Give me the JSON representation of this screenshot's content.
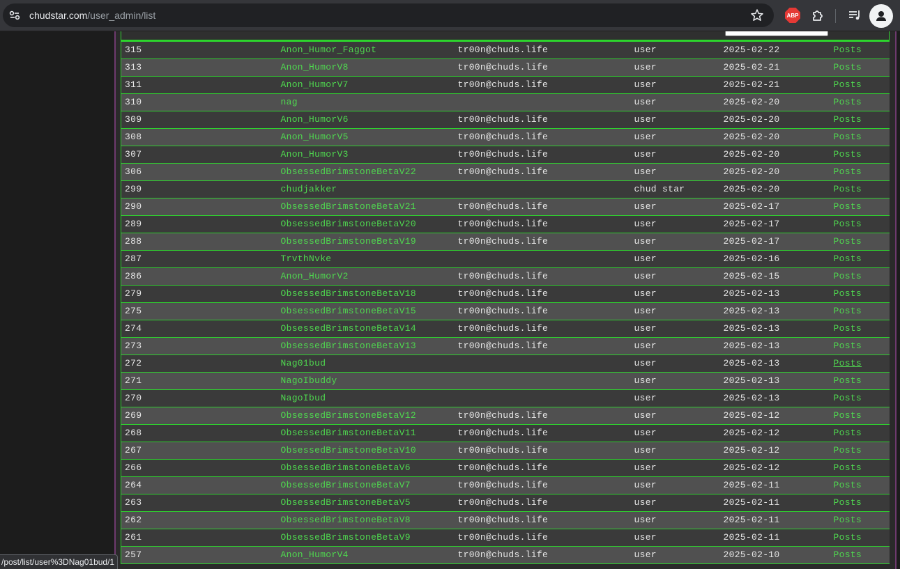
{
  "browser": {
    "url_host": "chudstar.com",
    "url_path": "/user_admin/list",
    "icons": [
      "tune-icon",
      "star-icon",
      "adblock-plus-icon",
      "extensions-icon",
      "media-controls-icon",
      "profile-icon"
    ],
    "abp_text": "ABP"
  },
  "status_bar": "/post/list/user%3DNag01bud/1",
  "colors": {
    "accent": "#2bd62b",
    "link": "#4fd84f",
    "row_dark": "#3a3a3a",
    "row_light": "#505050",
    "rule": "#6e3a6e"
  },
  "users": [
    {
      "id": "315",
      "name": "Anon_Humor_Faggot",
      "email": "tr00n@chuds.life",
      "role": "user",
      "date": "2025-02-22",
      "posts": "Posts"
    },
    {
      "id": "313",
      "name": "Anon_HumorV8",
      "email": "tr00n@chuds.life",
      "role": "user",
      "date": "2025-02-21",
      "posts": "Posts"
    },
    {
      "id": "311",
      "name": "Anon_HumorV7",
      "email": "tr00n@chuds.life",
      "role": "user",
      "date": "2025-02-21",
      "posts": "Posts"
    },
    {
      "id": "310",
      "name": "nag",
      "email": "",
      "role": "user",
      "date": "2025-02-20",
      "posts": "Posts"
    },
    {
      "id": "309",
      "name": "Anon_HumorV6",
      "email": "tr00n@chuds.life",
      "role": "user",
      "date": "2025-02-20",
      "posts": "Posts"
    },
    {
      "id": "308",
      "name": "Anon_HumorV5",
      "email": "tr00n@chuds.life",
      "role": "user",
      "date": "2025-02-20",
      "posts": "Posts"
    },
    {
      "id": "307",
      "name": "Anon_HumorV3",
      "email": "tr00n@chuds.life",
      "role": "user",
      "date": "2025-02-20",
      "posts": "Posts"
    },
    {
      "id": "306",
      "name": "ObsessedBrimstoneBetaV22",
      "email": "tr00n@chuds.life",
      "role": "user",
      "date": "2025-02-20",
      "posts": "Posts"
    },
    {
      "id": "299",
      "name": "chudjakker",
      "email": "",
      "role": "chud star",
      "date": "2025-02-20",
      "posts": "Posts"
    },
    {
      "id": "290",
      "name": "ObsessedBrimstoneBetaV21",
      "email": "tr00n@chuds.life",
      "role": "user",
      "date": "2025-02-17",
      "posts": "Posts"
    },
    {
      "id": "289",
      "name": "ObsessedBrimstoneBetaV20",
      "email": "tr00n@chuds.life",
      "role": "user",
      "date": "2025-02-17",
      "posts": "Posts"
    },
    {
      "id": "288",
      "name": "ObsessedBrimstoneBetaV19",
      "email": "tr00n@chuds.life",
      "role": "user",
      "date": "2025-02-17",
      "posts": "Posts"
    },
    {
      "id": "287",
      "name": "TrvthNvke",
      "email": "",
      "role": "user",
      "date": "2025-02-16",
      "posts": "Posts"
    },
    {
      "id": "286",
      "name": "Anon_HumorV2",
      "email": "tr00n@chuds.life",
      "role": "user",
      "date": "2025-02-15",
      "posts": "Posts"
    },
    {
      "id": "279",
      "name": "ObsessedBrimstoneBetaV18",
      "email": "tr00n@chuds.life",
      "role": "user",
      "date": "2025-02-13",
      "posts": "Posts"
    },
    {
      "id": "275",
      "name": "ObsessedBrimstoneBetaV15",
      "email": "tr00n@chuds.life",
      "role": "user",
      "date": "2025-02-13",
      "posts": "Posts"
    },
    {
      "id": "274",
      "name": "ObsessedBrimstoneBetaV14",
      "email": "tr00n@chuds.life",
      "role": "user",
      "date": "2025-02-13",
      "posts": "Posts"
    },
    {
      "id": "273",
      "name": "ObsessedBrimstoneBetaV13",
      "email": "tr00n@chuds.life",
      "role": "user",
      "date": "2025-02-13",
      "posts": "Posts"
    },
    {
      "id": "272",
      "name": "Nag01bud",
      "email": "",
      "role": "user",
      "date": "2025-02-13",
      "posts": "Posts",
      "hovered": true
    },
    {
      "id": "271",
      "name": "NagoIbuddy",
      "email": "",
      "role": "user",
      "date": "2025-02-13",
      "posts": "Posts"
    },
    {
      "id": "270",
      "name": "NagoIbud",
      "email": "",
      "role": "user",
      "date": "2025-02-13",
      "posts": "Posts"
    },
    {
      "id": "269",
      "name": "ObsessedBrimstoneBetaV12",
      "email": "tr00n@chuds.life",
      "role": "user",
      "date": "2025-02-12",
      "posts": "Posts"
    },
    {
      "id": "268",
      "name": "ObsessedBrimstoneBetaV11",
      "email": "tr00n@chuds.life",
      "role": "user",
      "date": "2025-02-12",
      "posts": "Posts"
    },
    {
      "id": "267",
      "name": "ObsessedBrimstoneBetaV10",
      "email": "tr00n@chuds.life",
      "role": "user",
      "date": "2025-02-12",
      "posts": "Posts"
    },
    {
      "id": "266",
      "name": "ObsessedBrimstoneBetaV6",
      "email": "tr00n@chuds.life",
      "role": "user",
      "date": "2025-02-12",
      "posts": "Posts"
    },
    {
      "id": "264",
      "name": "ObsessedBrimstoneBetaV7",
      "email": "tr00n@chuds.life",
      "role": "user",
      "date": "2025-02-11",
      "posts": "Posts"
    },
    {
      "id": "263",
      "name": "ObsessedBrimstoneBetaV5",
      "email": "tr00n@chuds.life",
      "role": "user",
      "date": "2025-02-11",
      "posts": "Posts"
    },
    {
      "id": "262",
      "name": "ObsessedBrimstoneBetaV8",
      "email": "tr00n@chuds.life",
      "role": "user",
      "date": "2025-02-11",
      "posts": "Posts"
    },
    {
      "id": "261",
      "name": "ObsessedBrimstoneBetaV9",
      "email": "tr00n@chuds.life",
      "role": "user",
      "date": "2025-02-11",
      "posts": "Posts"
    },
    {
      "id": "257",
      "name": "Anon_HumorV4",
      "email": "tr00n@chuds.life",
      "role": "user",
      "date": "2025-02-10",
      "posts": "Posts"
    }
  ]
}
